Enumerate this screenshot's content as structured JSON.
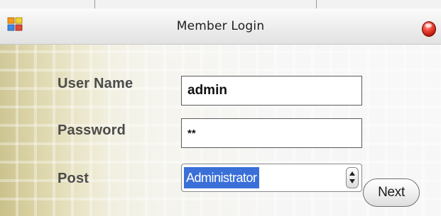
{
  "window": {
    "title": "Member Login"
  },
  "form": {
    "username_label": "User Name",
    "username_value": "admin",
    "password_label": "Password",
    "password_value": "**",
    "post_label": "Post",
    "post_selected": "Administrator"
  },
  "buttons": {
    "next_label": "Next"
  },
  "icons": {
    "app": "app-icon",
    "close": "close-icon",
    "select_arrows": "up-down-arrows-icon"
  },
  "colors": {
    "selection": "#3a6fd8",
    "close_button": "#e03324",
    "sidebar_tint": "#c9c08a"
  }
}
